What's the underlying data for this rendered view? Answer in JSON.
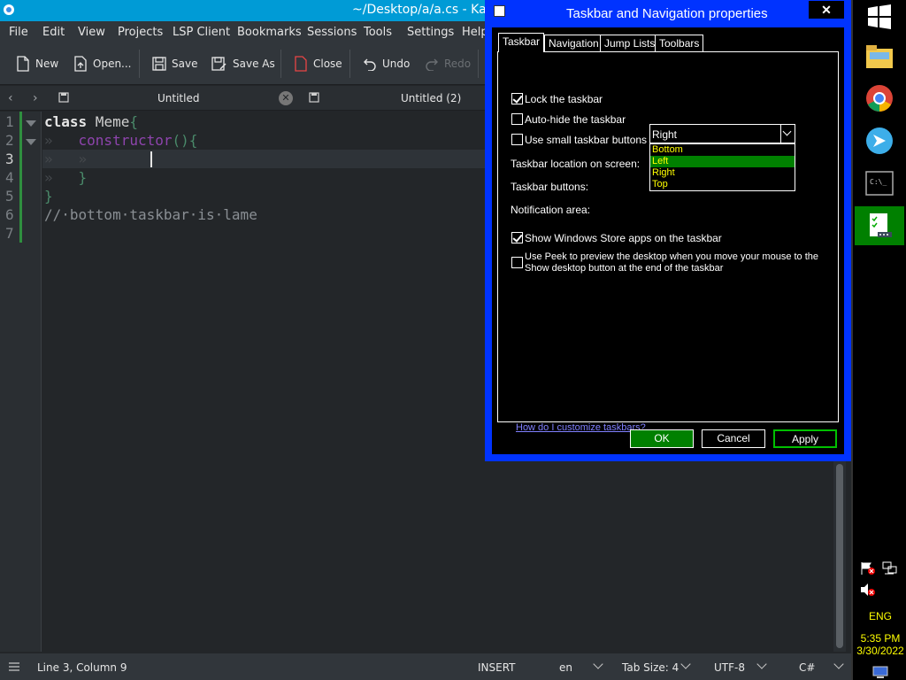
{
  "window": {
    "title": "~/Desktop/a/a.cs  - Ka"
  },
  "menu": [
    "File",
    "Edit",
    "View",
    "Projects",
    "LSP Client",
    "Bookmarks",
    "Sessions",
    "Tools",
    "Settings",
    "Help"
  ],
  "toolbar": {
    "new": "New",
    "open": "Open...",
    "save": "Save",
    "save_as": "Save As",
    "close": "Close",
    "undo": "Undo",
    "redo": "Redo"
  },
  "tabs": [
    {
      "label": "Untitled"
    },
    {
      "label": "Untitled (2)"
    }
  ],
  "editor": {
    "line_numbers": [
      "1",
      "2",
      "3",
      "4",
      "5",
      "6",
      "7"
    ],
    "lines": [
      {
        "kw": "class",
        "rest": " Meme",
        "brace": "{"
      },
      {
        "indent": "»   ",
        "fn": "constructor",
        "rest": "(){"
      },
      {
        "indent": "»   »   "
      },
      {
        "indent": "»   ",
        "brace": "}"
      },
      {
        "brace": "}"
      },
      {
        "comment": "//·bottom·taskbar·is·lame"
      },
      {}
    ]
  },
  "status": {
    "position": "Line 3, Column 9",
    "mode": "INSERT",
    "lang": "en",
    "tab_size": "Tab Size: 4",
    "encoding": "UTF-8",
    "syntax": "C#"
  },
  "dialog": {
    "title": "Taskbar and Navigation properties",
    "close": "✕",
    "tabs": [
      "Taskbar",
      "Navigation",
      "Jump Lists",
      "Toolbars"
    ],
    "lock": "Lock the taskbar",
    "autohide": "Auto-hide the taskbar",
    "small": "Use small taskbar buttons",
    "location_label": "Taskbar location on screen:",
    "location_value": "Right",
    "buttons_label": "Taskbar buttons:",
    "notification_label": "Notification area:",
    "options": [
      "Bottom",
      "Left",
      "Right",
      "Top"
    ],
    "store": "Show Windows Store apps on the taskbar",
    "peek_1": "Use Peek to preview the desktop when you move your mouse to the",
    "peek_2": "Show desktop button at the end of the taskbar",
    "help": "How do I customize taskbars?",
    "ok": "OK",
    "cancel": "Cancel",
    "apply": "Apply"
  },
  "taskbar": {
    "lang": "ENG",
    "time": "5:35 PM",
    "date": "3/30/2022"
  }
}
